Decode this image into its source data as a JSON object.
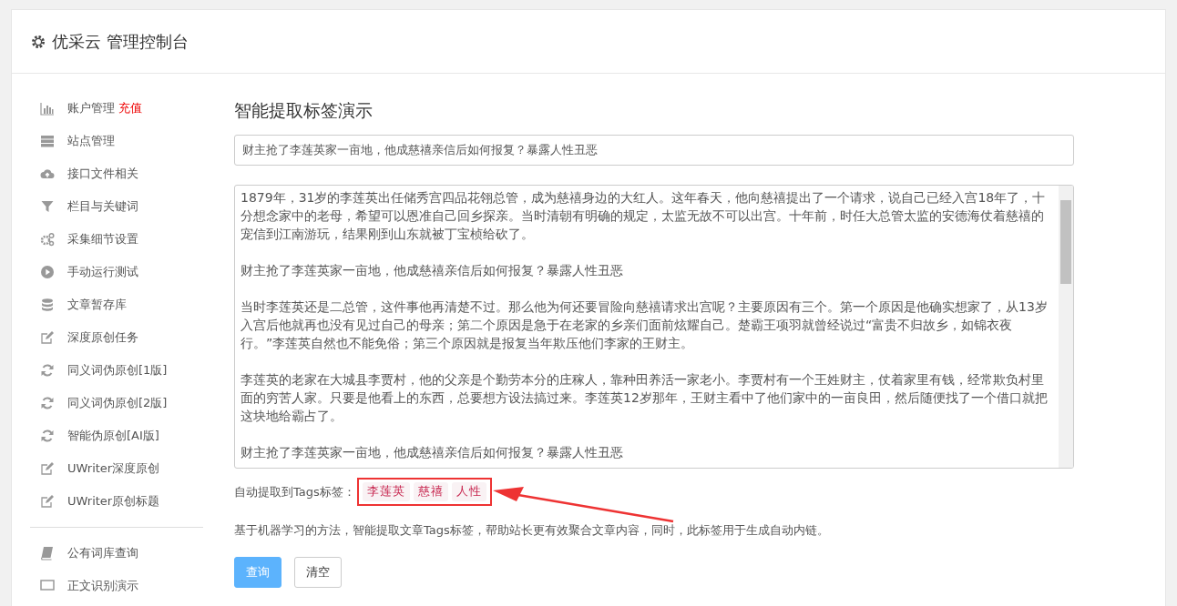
{
  "header": {
    "title": "优采云 管理控制台"
  },
  "sidebar": {
    "groups": [
      {
        "items": [
          {
            "label": "账户管理",
            "badge": "充值",
            "kind": "bars"
          },
          {
            "label": "站点管理",
            "kind": "server"
          },
          {
            "label": "接口文件相关",
            "kind": "cloud"
          },
          {
            "label": "栏目与关键词",
            "kind": "filter"
          },
          {
            "label": "采集细节设置",
            "kind": "gears"
          },
          {
            "label": "手动运行测试",
            "kind": "play"
          },
          {
            "label": "文章暂存库",
            "kind": "database"
          },
          {
            "label": "深度原创任务",
            "kind": "edit"
          },
          {
            "label": "同义词伪原创[1版]",
            "kind": "refresh"
          },
          {
            "label": "同义词伪原创[2版]",
            "kind": "refresh"
          },
          {
            "label": "智能伪原创[AI版]",
            "kind": "refresh"
          },
          {
            "label": "UWriter深度原创",
            "kind": "edit"
          },
          {
            "label": "UWriter原创标题",
            "kind": "edit"
          }
        ]
      },
      {
        "items": [
          {
            "label": "公有词库查询",
            "kind": "book"
          },
          {
            "label": "正文识别演示",
            "kind": "monitor"
          }
        ]
      }
    ]
  },
  "main": {
    "title": "智能提取标签演示",
    "title_field": {
      "value": "财主抢了李莲英家一亩地，他成慈禧亲信后如何报复？暴露人性丑恶"
    },
    "article": {
      "paragraphs": [
        "1879年，31岁的李莲英出任储秀宫四品花翎总管，成为慈禧身边的大红人。这年春天，他向慈禧提出了一个请求，说自己已经入宫18年了，十分想念家中的老母，希望可以恩准自己回乡探亲。当时清朝有明确的规定，太监无故不可以出宫。十年前，时任大总管太监的安德海仗着慈禧的宠信到江南游玩，结果刚到山东就被丁宝桢给砍了。",
        "财主抢了李莲英家一亩地，他成慈禧亲信后如何报复？暴露人性丑恶",
        "当时李莲英还是二总管，这件事他再清楚不过。那么他为何还要冒险向慈禧请求出宫呢？主要原因有三个。第一个原因是他确实想家了，从13岁入宫后他就再也没有见过自己的母亲；第二个原因是急于在老家的乡亲们面前炫耀自己。楚霸王项羽就曾经说过“富贵不归故乡，如锦衣夜行。”李莲英自然也不能免俗；第三个原因就是报复当年欺压他们李家的王财主。",
        "李莲英的老家在大城县李贾村，他的父亲是个勤劳本分的庄稼人，靠种田养活一家老小。李贾村有一个王姓财主，仗着家里有钱，经常欺负村里面的穷苦人家。只要是他看上的东西，总要想方设法搞过来。李莲英12岁那年，王财主看中了他们家中的一亩良田，然后随便找了一个借口就把这块地给霸占了。",
        "财主抢了李莲英家一亩地，他成慈禧亲信后如何报复？暴露人性丑恶"
      ]
    },
    "tags_label": "自动提取到Tags标签：",
    "tags": [
      "李莲英",
      "慈禧",
      "人性"
    ],
    "description": "基于机器学习的方法，智能提取文章Tags标签，帮助站长更有效聚合文章内容，同时，此标签用于生成自动内链。",
    "buttons": [
      {
        "label": "查询",
        "kind": "primary"
      },
      {
        "label": "清空",
        "kind": "default"
      }
    ]
  }
}
